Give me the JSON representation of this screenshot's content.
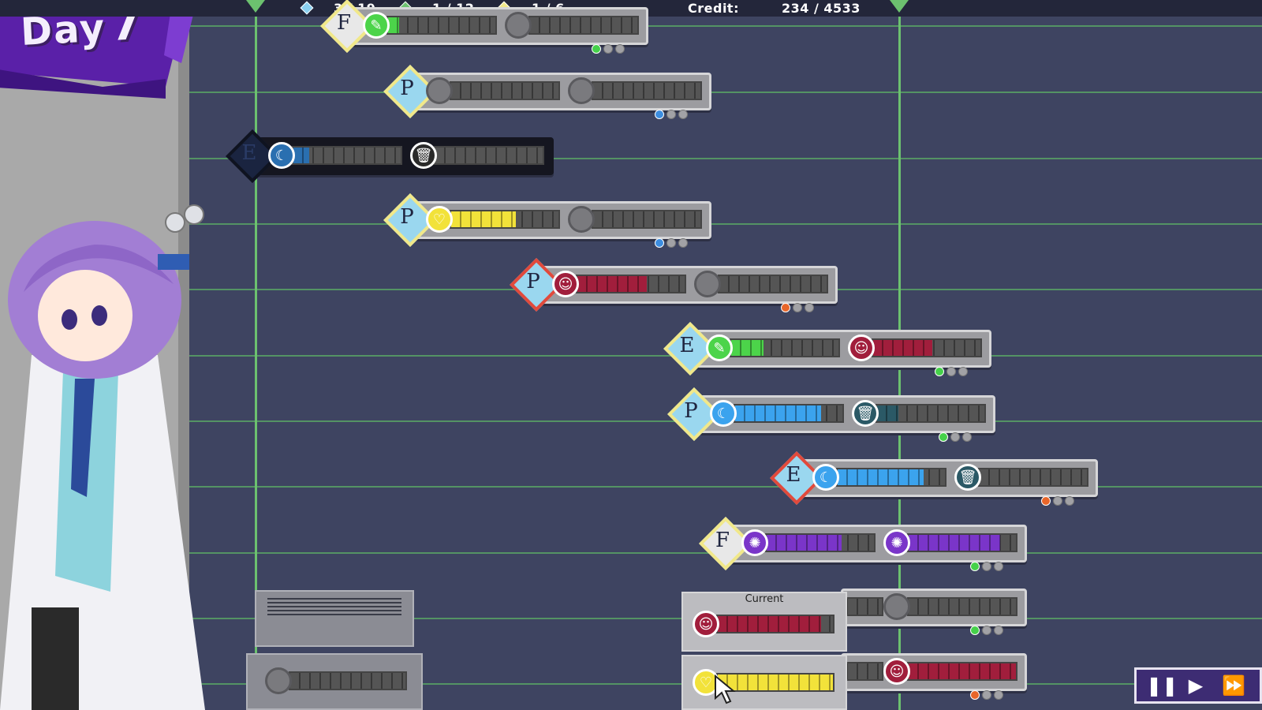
{
  "hud": {
    "stat1": "3 / 19",
    "stat2": "1 / 12",
    "stat3": "1 / 6",
    "credit_label": "Credit:",
    "credit_value": "234 / 4533"
  },
  "day": {
    "word": "Day",
    "number": "7"
  },
  "tasks": [
    {
      "letter": "F",
      "type": "f",
      "slot1": {
        "icon": "green-wrench-icon",
        "color": "#4cd44a",
        "fill": 0.1
      },
      "slot2": {
        "icon": "empty-slot-icon",
        "color": "#666",
        "fill": 0
      },
      "dots_color": "#45d14a"
    },
    {
      "letter": "P",
      "type": "p",
      "slot1": {
        "icon": "empty-slot-icon",
        "color": "#666",
        "fill": 0
      },
      "slot2": {
        "icon": "empty-slot-icon",
        "color": "#666",
        "fill": 0
      },
      "dots_color": "#3c8de0"
    },
    {
      "letter": "E",
      "type": "dark",
      "slot1": {
        "icon": "moon-icon",
        "color": "#2a6fb0",
        "fill": 0.15
      },
      "slot2": {
        "icon": "trash-icon",
        "color": "#2a2a2a",
        "fill": 0
      },
      "dots_color": ""
    },
    {
      "letter": "P",
      "type": "p",
      "slot1": {
        "icon": "heart-icon",
        "color": "#f2e23a",
        "fill": 0.6
      },
      "slot2": {
        "icon": "empty-slot-icon",
        "color": "#666",
        "fill": 0
      },
      "dots_color": "#3c8de0"
    },
    {
      "letter": "P",
      "type": "p-red",
      "slot1": {
        "icon": "smile-icon",
        "color": "#a11e3c",
        "fill": 0.65
      },
      "slot2": {
        "icon": "empty-slot-icon",
        "color": "#666",
        "fill": 0
      },
      "dots_color": "#e8662a"
    },
    {
      "letter": "E",
      "type": "p",
      "slot1": {
        "icon": "green-wrench-icon",
        "color": "#4cd44a",
        "fill": 0.3
      },
      "slot2": {
        "icon": "smile-icon",
        "color": "#a11e3c",
        "fill": 0.55
      },
      "dots_color": "#45d14a"
    },
    {
      "letter": "P",
      "type": "p",
      "slot1": {
        "icon": "moon-icon",
        "color": "#3ba3ee",
        "fill": 0.8
      },
      "slot2": {
        "icon": "trash-icon",
        "color": "#2b5966",
        "fill": 0.2
      },
      "dots_color": "#45d14a"
    },
    {
      "letter": "E",
      "type": "p-red",
      "slot1": {
        "icon": "moon-icon",
        "color": "#3ba3ee",
        "fill": 0.8
      },
      "slot2": {
        "icon": "trash-icon",
        "color": "#2b5966",
        "fill": 0
      },
      "dots_color": "#e8662a"
    },
    {
      "letter": "F",
      "type": "f",
      "slot1": {
        "icon": "purple-flame-icon",
        "color": "#7a35c9",
        "fill": 0.7
      },
      "slot2": {
        "icon": "purple-flame-icon",
        "color": "#7a35c9",
        "fill": 0.85
      },
      "dots_color": "#45d14a"
    },
    {
      "letter": "",
      "type": "partial",
      "slot1": {
        "icon": "",
        "color": "#666",
        "fill": 0
      },
      "slot2": {
        "icon": "empty-slot-icon",
        "color": "#666",
        "fill": 0
      },
      "dots_color": "#45d14a"
    },
    {
      "letter": "",
      "type": "partial",
      "slot1": {
        "icon": "",
        "color": "#666",
        "fill": 0
      },
      "slot2": {
        "icon": "smile-icon",
        "color": "#a11e3c",
        "fill": 1.0
      },
      "dots_color": "#e8662a"
    }
  ],
  "current": {
    "label": "Current",
    "slot1": {
      "icon": "smile-icon",
      "color": "#a11e3c",
      "fill": 0.9
    },
    "slot2": {
      "icon": "heart-icon",
      "color": "#f2e23a",
      "fill": 1.0
    }
  },
  "machine": {
    "slot": {
      "icon": "empty-slot-icon",
      "color": "#666",
      "fill": 0
    }
  },
  "controls": {
    "pause": "❚❚",
    "play": "▶",
    "fast": "⏩"
  },
  "colors": {
    "board": "#3e4461",
    "grid_line": "#5cae66",
    "banner": "#5a20a8",
    "controls_bg": "#3d2c73"
  }
}
